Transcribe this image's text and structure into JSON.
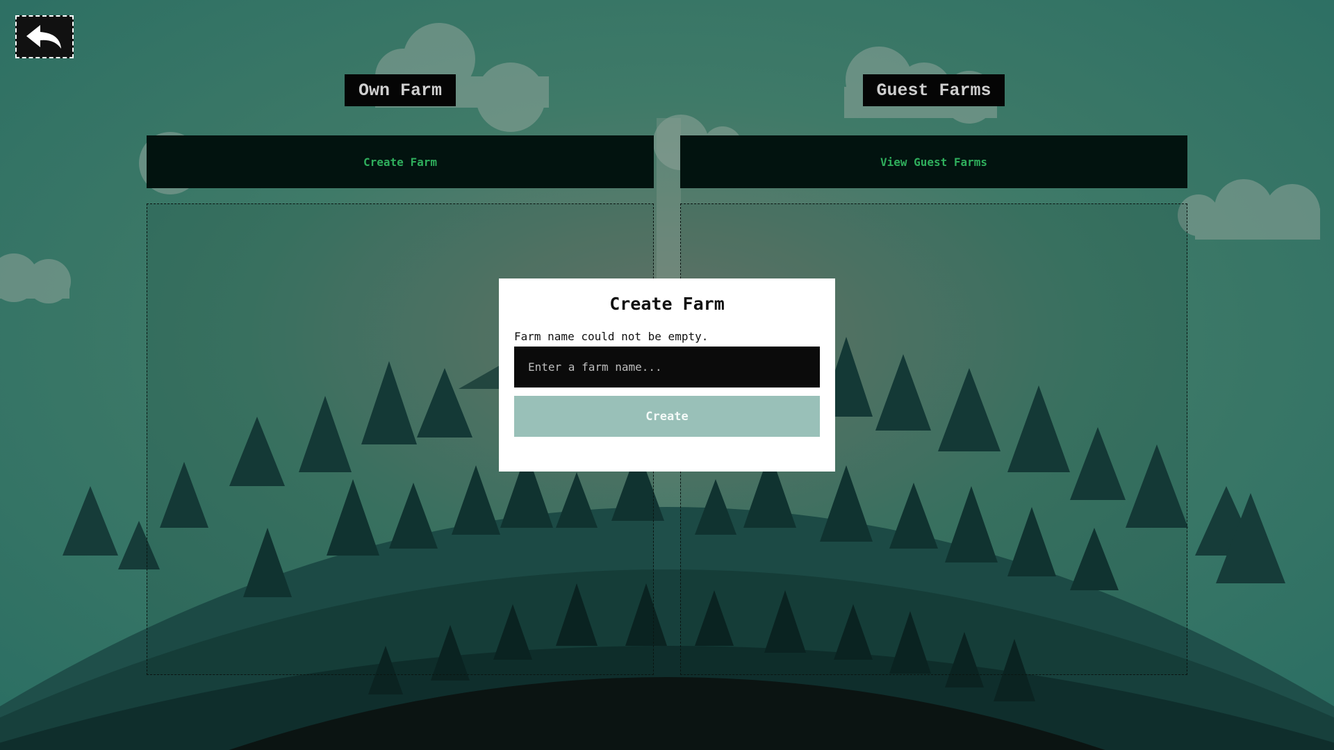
{
  "header": {
    "back_icon": "back-arrow-icon"
  },
  "own": {
    "title": "Own Farm",
    "action_label": "Create Farm"
  },
  "guest": {
    "title": "Guest Farms",
    "action_label": "View Guest Farms"
  },
  "modal": {
    "title": "Create Farm",
    "error": "Farm name could not be empty.",
    "input_placeholder": "Enter a farm name...",
    "input_value": "",
    "submit_label": "Create"
  },
  "colors": {
    "accent_text": "#2fae5c",
    "button_disabled": "#99c0b8",
    "background": "#2f7565"
  }
}
